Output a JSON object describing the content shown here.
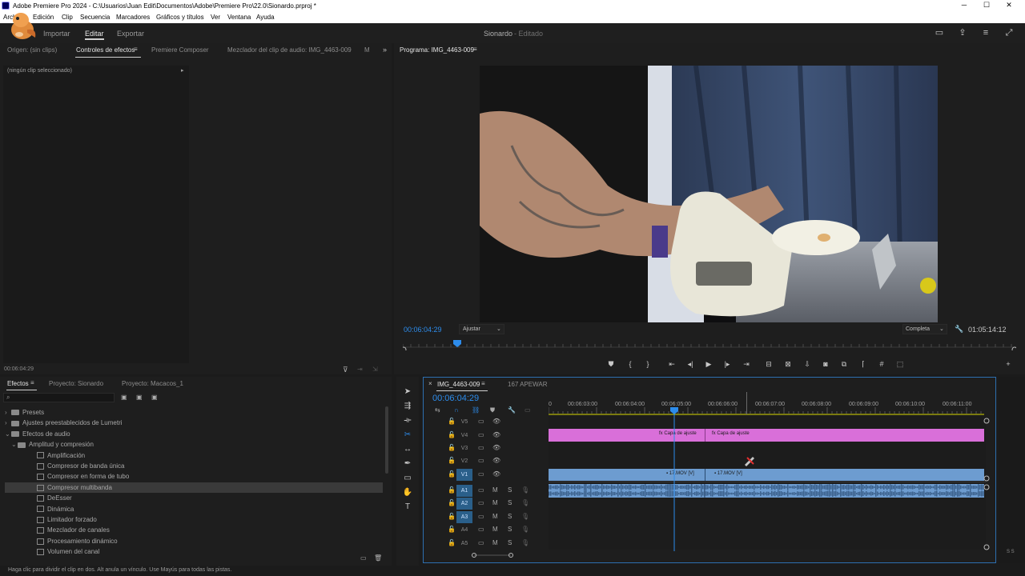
{
  "window": {
    "title": "Adobe Premiere Pro 2024 - C:\\Usuarios\\Juan Edit\\Documentos\\Adobe\\Premiere Pro\\22.0\\Sionardo.prproj *",
    "minimize": "─",
    "maximize": "☐",
    "close": "✕"
  },
  "menu": [
    "Archivo",
    "Edición",
    "Clip",
    "Secuencia",
    "Marcadores",
    "Gráficos y títulos",
    "Ver",
    "Ventana",
    "Ayuda"
  ],
  "workspace": {
    "tabs": [
      "Importar",
      "Editar",
      "Exportar"
    ],
    "active": "Editar",
    "project_name": "Sionardo",
    "project_status": "- Editado"
  },
  "source_panel": {
    "tabs": [
      "Origen: (sin clips)",
      "Controles de efectos",
      "Premiere Composer",
      "Mezclador del clip de audio: IMG_4463-009",
      "M"
    ],
    "active_tab": "Controles de efectos",
    "no_clip_text": "(ningún clip seleccionado)",
    "timecode": "00:06:04:29"
  },
  "program_monitor": {
    "title": "Programa: IMG_4463-009",
    "timecode": "00:06:04:29",
    "fit_label": "Ajustar",
    "quality_label": "Completa",
    "duration": "01:05:14:12"
  },
  "effects_panel": {
    "tabs": [
      "Efectos",
      "Proyecto: Sionardo",
      "Proyecto: Macacos_1"
    ],
    "active_tab": "Efectos",
    "search_placeholder": "",
    "items": [
      {
        "label": "Presets",
        "level": 0,
        "type": "folder",
        "expanded": false
      },
      {
        "label": "Ajustes preestablecidos de Lumetri",
        "level": 0,
        "type": "folder",
        "expanded": false
      },
      {
        "label": "Efectos de audio",
        "level": 0,
        "type": "folder",
        "expanded": true
      },
      {
        "label": "Amplitud y compresión",
        "level": 1,
        "type": "folder",
        "expanded": true
      },
      {
        "label": "Amplificación",
        "level": 2,
        "type": "effect"
      },
      {
        "label": "Compresor de banda única",
        "level": 2,
        "type": "effect"
      },
      {
        "label": "Compresor en forma de tubo",
        "level": 2,
        "type": "effect"
      },
      {
        "label": "Compresor multibanda",
        "level": 2,
        "type": "effect",
        "selected": true
      },
      {
        "label": "DeEsser",
        "level": 2,
        "type": "effect"
      },
      {
        "label": "Dinámica",
        "level": 2,
        "type": "effect"
      },
      {
        "label": "Limitador forzado",
        "level": 2,
        "type": "effect"
      },
      {
        "label": "Mezclador de canales",
        "level": 2,
        "type": "effect"
      },
      {
        "label": "Procesamiento dinámico",
        "level": 2,
        "type": "effect"
      },
      {
        "label": "Volumen del canal",
        "level": 2,
        "type": "effect"
      }
    ]
  },
  "timeline": {
    "tabs": [
      "IMG_4463-009",
      "167 APEWAR"
    ],
    "active_tab": "IMG_4463-009",
    "close_glyph": "×",
    "timecode": "00:06:04:29",
    "ruler": [
      "00:06:03:00",
      "00:06:04:00",
      "00:06:05:00",
      "00:06:06:00",
      "00:06:07:00",
      "00:06:08:00",
      "00:06:09:00",
      "00:06:10:00",
      "00:06:11:00"
    ],
    "video_tracks": [
      "V5",
      "V4",
      "V3",
      "V2",
      "V1"
    ],
    "audio_tracks": [
      "A1",
      "A2",
      "A3",
      "A4",
      "A5"
    ],
    "mute": "M",
    "solo": "S",
    "adjust_clip_1": "Capa de ajuste",
    "adjust_clip_2": "Capa de ajuste",
    "video_clip_1": "17.MOV [V]",
    "video_clip_2": "17.MOV [V]",
    "meter_label": "S S"
  },
  "status_bar": "Haga clic para dividir el clip en dos. Alt anula un vínculo. Use Mayús para todas las pistas.",
  "colors": {
    "accent": "#2d8ceb",
    "adjustment_clip": "#d96fd9",
    "video_clip": "#6d9cd0",
    "audio_clip": "#6d9cd0",
    "target_on": "#2a5f8a"
  },
  "icons": {
    "razor_tool": "razor-icon",
    "selection_tool": "arrow-icon"
  }
}
